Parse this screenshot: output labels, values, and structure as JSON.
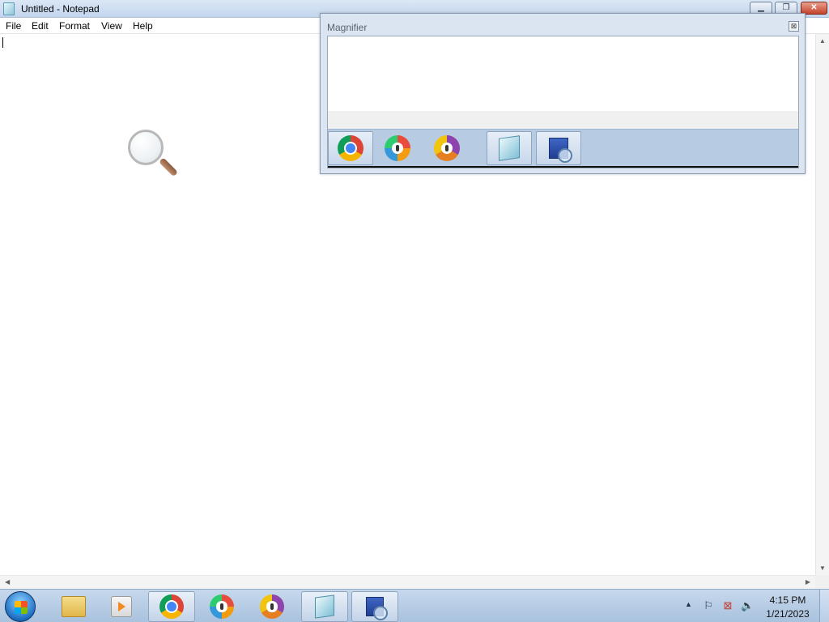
{
  "notepad": {
    "title": "Untitled - Notepad",
    "menu": [
      "File",
      "Edit",
      "Format",
      "View",
      "Help"
    ],
    "content": ""
  },
  "magnifier": {
    "title": "Magnifier",
    "close_glyph": "⊠"
  },
  "window_controls": {
    "minimize": "▁",
    "maximize": "❐",
    "close": "✕"
  },
  "taskbar": {
    "pinned": [
      "windows-explorer",
      "media-player",
      "chrome",
      "avast-secure-browser",
      "avast-secure-browser-alt",
      "notepad",
      "magnifier"
    ],
    "active": [
      "notepad",
      "magnifier"
    ],
    "tray": {
      "show_hidden_glyph": "▲",
      "time": "4:15 PM",
      "date": "1/21/2023"
    }
  }
}
